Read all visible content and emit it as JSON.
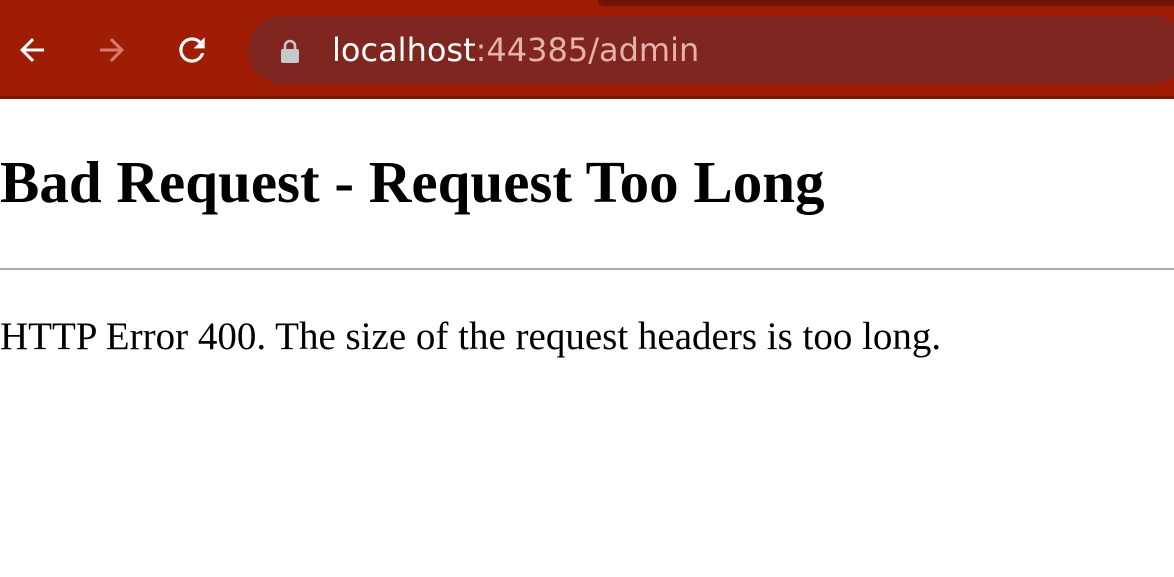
{
  "browser": {
    "address_bar": {
      "host": "localhost",
      "rest": ":44385/admin"
    },
    "icons": {
      "back": "arrow-left-icon",
      "forward": "arrow-right-icon",
      "reload": "reload-icon",
      "lock": "lock-icon"
    },
    "colors": {
      "toolbar": "#a01d05",
      "omnibox": "#802620",
      "url_host": "#ffffff",
      "url_rest": "#e5b2ac"
    }
  },
  "page": {
    "title": "Bad Request - Request Too Long",
    "message": "HTTP Error 400. The size of the request headers is too long."
  }
}
